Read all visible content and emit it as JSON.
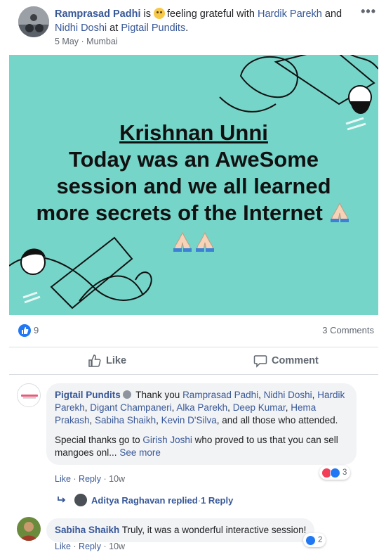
{
  "post": {
    "author": "Ramprasad Padhi",
    "verb_is": " is ",
    "feeling": "feeling grateful with ",
    "tag1": "Hardik Parekh",
    "and": " and ",
    "tag2": "Nidhi Doshi",
    "at": " at ",
    "place": "Pigtail Pundits",
    "period": ".",
    "date": "5 May",
    "dot_sep": " · ",
    "location": "Mumbai",
    "more_label": "•••"
  },
  "image": {
    "title": "Krishnan Unni",
    "line1": "Today was an AweSome",
    "line2": "session and we all learned",
    "line3": "more secrets of the Internet",
    "bg_color": "#75d5c9"
  },
  "stats": {
    "reaction_count": "9",
    "comments": "3 Comments"
  },
  "actions": {
    "like": "Like",
    "comment": "Comment"
  },
  "comments": [
    {
      "author": "Pigtail Pundits",
      "p1_a": " Thank you ",
      "t1": "Ramprasad Padhi",
      "c1": ", ",
      "t2": "Nidhi Doshi",
      "c2": ",",
      "t3": "Hardik Parekh",
      "c3": ", ",
      "t4": "Digant Champaneri",
      "c4": ", ",
      "t5": "Alka Parekh",
      "c5": ", ",
      "t6": "Deep Kumar",
      "c6": ",",
      "t7": "Hema Prakash",
      "c7": ", ",
      "t8": "Sabiha Shaikh",
      "c8": ", ",
      "t9": "Kevin D'Silva",
      "p1_end": ", and all those who attended.",
      "p2_a": "Special thanks go to ",
      "t10": "Girish Joshi",
      "p2_b": " who proved to us that you can sell mangoes onl... ",
      "see_more": "See more",
      "like": "Like",
      "reply": "Reply",
      "age": "10w",
      "reaction_count": "3",
      "replies_author": "Aditya Raghavan replied",
      "replies_count": "1 Reply"
    },
    {
      "author": "Sabiha Shaikh",
      "text": " Truly, it was a wonderful interactive session!",
      "like": "Like",
      "reply": "Reply",
      "age": "10w",
      "reaction_count": "2"
    }
  ]
}
